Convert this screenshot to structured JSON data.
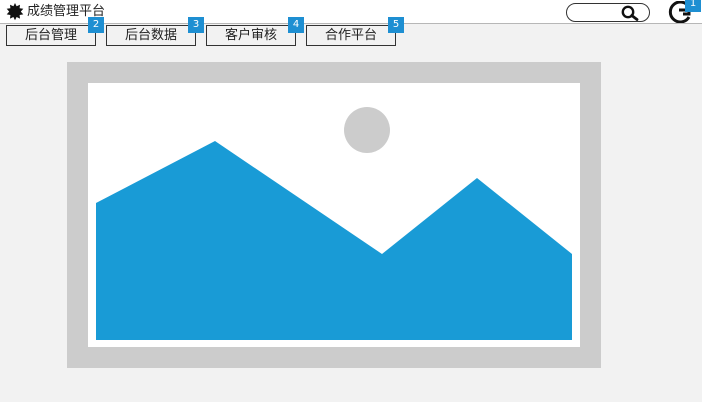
{
  "app": {
    "title": "成绩管理平台",
    "logo_icon": "gear-burst-icon"
  },
  "header": {
    "search": {
      "placeholder": "",
      "icon": "search-icon"
    },
    "user_icon": "user-refresh-icon",
    "user_badge": "1"
  },
  "nav": {
    "items": [
      {
        "label": "后台管理",
        "badge": "2"
      },
      {
        "label": "后台数据",
        "badge": "3"
      },
      {
        "label": "客户审核",
        "badge": "4"
      },
      {
        "label": "合作平台",
        "badge": "5"
      }
    ]
  },
  "main": {
    "image_placeholder_icon": "image-placeholder-icon"
  },
  "colors": {
    "accent": "#1e8fd2",
    "mountain": "#199bd6",
    "frame": "#cccccc",
    "sun": "#cccccc",
    "background": "#f2f2f2"
  }
}
